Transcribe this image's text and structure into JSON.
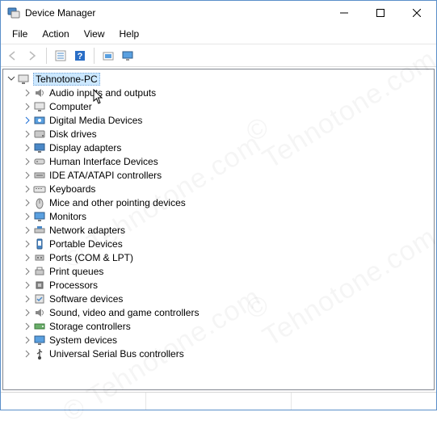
{
  "window": {
    "title": "Device Manager"
  },
  "menubar": {
    "items": [
      "File",
      "Action",
      "View",
      "Help"
    ]
  },
  "toolbar": {
    "back": "Back",
    "forward": "Forward",
    "properties": "Properties",
    "help": "Help",
    "scan": "Scan for hardware changes",
    "show": "Show hidden"
  },
  "tree": {
    "root": {
      "label": "Tehnotone-PC"
    },
    "items": [
      {
        "label": "Audio inputs and outputs",
        "icon": "speaker"
      },
      {
        "label": "Computer",
        "icon": "computer"
      },
      {
        "label": "Digital Media Devices",
        "icon": "media",
        "expanderBlue": true
      },
      {
        "label": "Disk drives",
        "icon": "disk"
      },
      {
        "label": "Display adapters",
        "icon": "display"
      },
      {
        "label": "Human Interface Devices",
        "icon": "hid"
      },
      {
        "label": "IDE ATA/ATAPI controllers",
        "icon": "ide"
      },
      {
        "label": "Keyboards",
        "icon": "keyboard"
      },
      {
        "label": "Mice and other pointing devices",
        "icon": "mouse"
      },
      {
        "label": "Monitors",
        "icon": "monitor"
      },
      {
        "label": "Network adapters",
        "icon": "network"
      },
      {
        "label": "Portable Devices",
        "icon": "portable"
      },
      {
        "label": "Ports (COM & LPT)",
        "icon": "ports"
      },
      {
        "label": "Print queues",
        "icon": "printer"
      },
      {
        "label": "Processors",
        "icon": "cpu"
      },
      {
        "label": "Software devices",
        "icon": "software"
      },
      {
        "label": "Sound, video and game controllers",
        "icon": "sound"
      },
      {
        "label": "Storage controllers",
        "icon": "storage"
      },
      {
        "label": "System devices",
        "icon": "system"
      },
      {
        "label": "Universal Serial Bus controllers",
        "icon": "usb"
      }
    ]
  },
  "watermark": "© Tehnotone.com"
}
